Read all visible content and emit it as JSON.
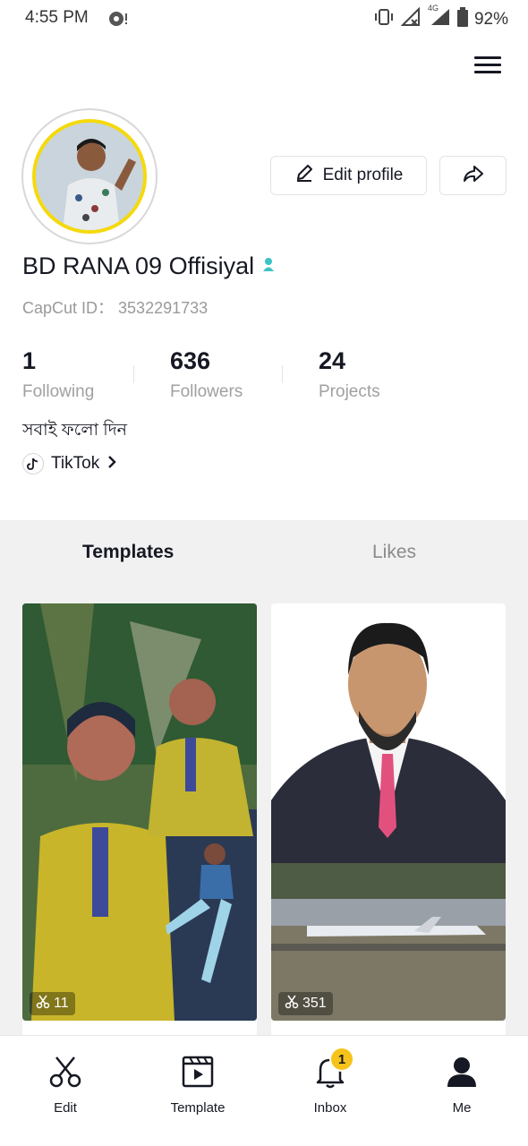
{
  "status": {
    "time": "4:55 PM",
    "network": "4G",
    "battery": "92%"
  },
  "header": {
    "menu_icon": "hamburger-menu-icon"
  },
  "profile": {
    "edit_label": "Edit profile",
    "name": "BD RANA 09 Offisiyal",
    "capcut_id": "CapCut ID： 3532291733",
    "bio": "সবাই ফলো দিন",
    "link_label": "TikTok"
  },
  "stats": [
    {
      "value": "1",
      "label": "Following"
    },
    {
      "value": "636",
      "label": "Followers"
    },
    {
      "value": "24",
      "label": "Projects"
    }
  ],
  "tabs": {
    "templates": "Templates",
    "likes": "Likes"
  },
  "templates": [
    {
      "count": "11"
    },
    {
      "count": "351"
    }
  ],
  "nav": {
    "edit": "Edit",
    "template": "Template",
    "inbox": "Inbox",
    "inbox_badge": "1",
    "me": "Me"
  },
  "colors": {
    "accent_yellow": "#f6c31b",
    "text_primary": "#161823",
    "text_secondary": "#9a9a9a",
    "verified_teal": "#3cc4c4"
  }
}
